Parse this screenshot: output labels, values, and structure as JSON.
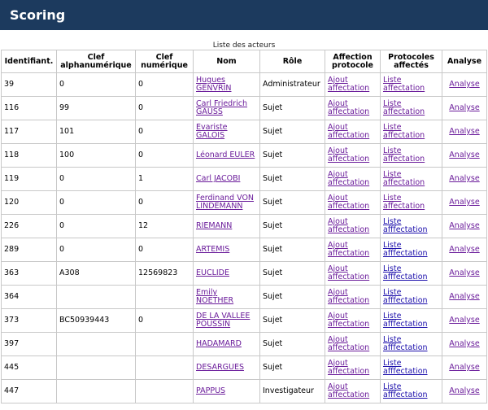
{
  "header": {
    "title": "Scoring"
  },
  "table": {
    "caption": "Liste des acteurs",
    "columns": {
      "ident": "Identifiant.",
      "alpha": "Clef alphanumérique",
      "num": "Clef numérique",
      "nom": "Nom",
      "role": "Rôle",
      "affect": "Affection protocole",
      "protocoles": "Protocoles affectés",
      "analyse": "Analyse"
    },
    "rows": [
      {
        "id": "39",
        "alpha": "0",
        "num": "0",
        "nom": "Hugues GENVRIN",
        "role": "Administrateur",
        "ajout": "Ajout affectation",
        "liste": "Liste affectation",
        "analyse": "Analyse"
      },
      {
        "id": "116",
        "alpha": "99",
        "num": "0",
        "nom": "Carl Friedrich GAUSS",
        "role": "Sujet",
        "ajout": "Ajout affectation",
        "liste": "Liste affectation",
        "analyse": "Analyse"
      },
      {
        "id": "117",
        "alpha": "101",
        "num": "0",
        "nom": "Evariste GALOIS",
        "role": "Sujet",
        "ajout": "Ajout affectation",
        "liste": "Liste affectation",
        "analyse": "Analyse"
      },
      {
        "id": "118",
        "alpha": "100",
        "num": "0",
        "nom": "Léonard EULER",
        "role": "Sujet",
        "ajout": "Ajout affectation",
        "liste": "Liste affectation",
        "analyse": "Analyse"
      },
      {
        "id": "119",
        "alpha": "0",
        "num": "1",
        "nom": "Carl JACOBI",
        "role": "Sujet",
        "ajout": "Ajout affectation",
        "liste": "Liste affectation",
        "analyse": "Analyse"
      },
      {
        "id": "120",
        "alpha": "0",
        "num": "0",
        "nom": "Ferdinand VON LINDEMANN",
        "role": "Sujet",
        "ajout": "Ajout affectation",
        "liste": "Liste affectation",
        "analyse": "Analyse"
      },
      {
        "id": "226",
        "alpha": "0",
        "num": "12",
        "nom": "RIEMANN",
        "role": "Sujet",
        "ajout": "Ajout affectation",
        "liste": "Liste afffectation",
        "analyse": "Analyse"
      },
      {
        "id": "289",
        "alpha": "0",
        "num": "0",
        "nom": "ARTEMIS",
        "role": "Sujet",
        "ajout": "Ajout affectation",
        "liste": "Liste afffectation",
        "analyse": "Analyse"
      },
      {
        "id": "363",
        "alpha": "A308",
        "num": "12569823",
        "nom": "EUCLIDE",
        "role": "Sujet",
        "ajout": "Ajout affectation",
        "liste": "Liste afffectation",
        "analyse": "Analyse"
      },
      {
        "id": "364",
        "alpha": "",
        "num": "",
        "nom": "Emily NOETHER",
        "role": "Sujet",
        "ajout": "Ajout affectation",
        "liste": "Liste afffectation",
        "analyse": "Analyse"
      },
      {
        "id": "373",
        "alpha": "BC50939443",
        "num": "0",
        "nom": "DE LA VALLEE POUSSIN",
        "role": "Sujet",
        "ajout": "Ajout affectation",
        "liste": "Liste afffectation",
        "analyse": "Analyse"
      },
      {
        "id": "397",
        "alpha": "",
        "num": "",
        "nom": "HADAMARD",
        "role": "Sujet",
        "ajout": "Ajout affectation",
        "liste": "Liste afffectation",
        "analyse": "Analyse"
      },
      {
        "id": "445",
        "alpha": "",
        "num": "",
        "nom": "DESARGUES",
        "role": "Sujet",
        "ajout": "Ajout affectation",
        "liste": "Liste afffectation",
        "analyse": "Analyse"
      },
      {
        "id": "447",
        "alpha": "",
        "num": "",
        "nom": "PAPPUS",
        "role": "Investigateur",
        "ajout": "Ajout affectation",
        "liste": "Liste afffectation",
        "analyse": "Analyse"
      }
    ]
  }
}
